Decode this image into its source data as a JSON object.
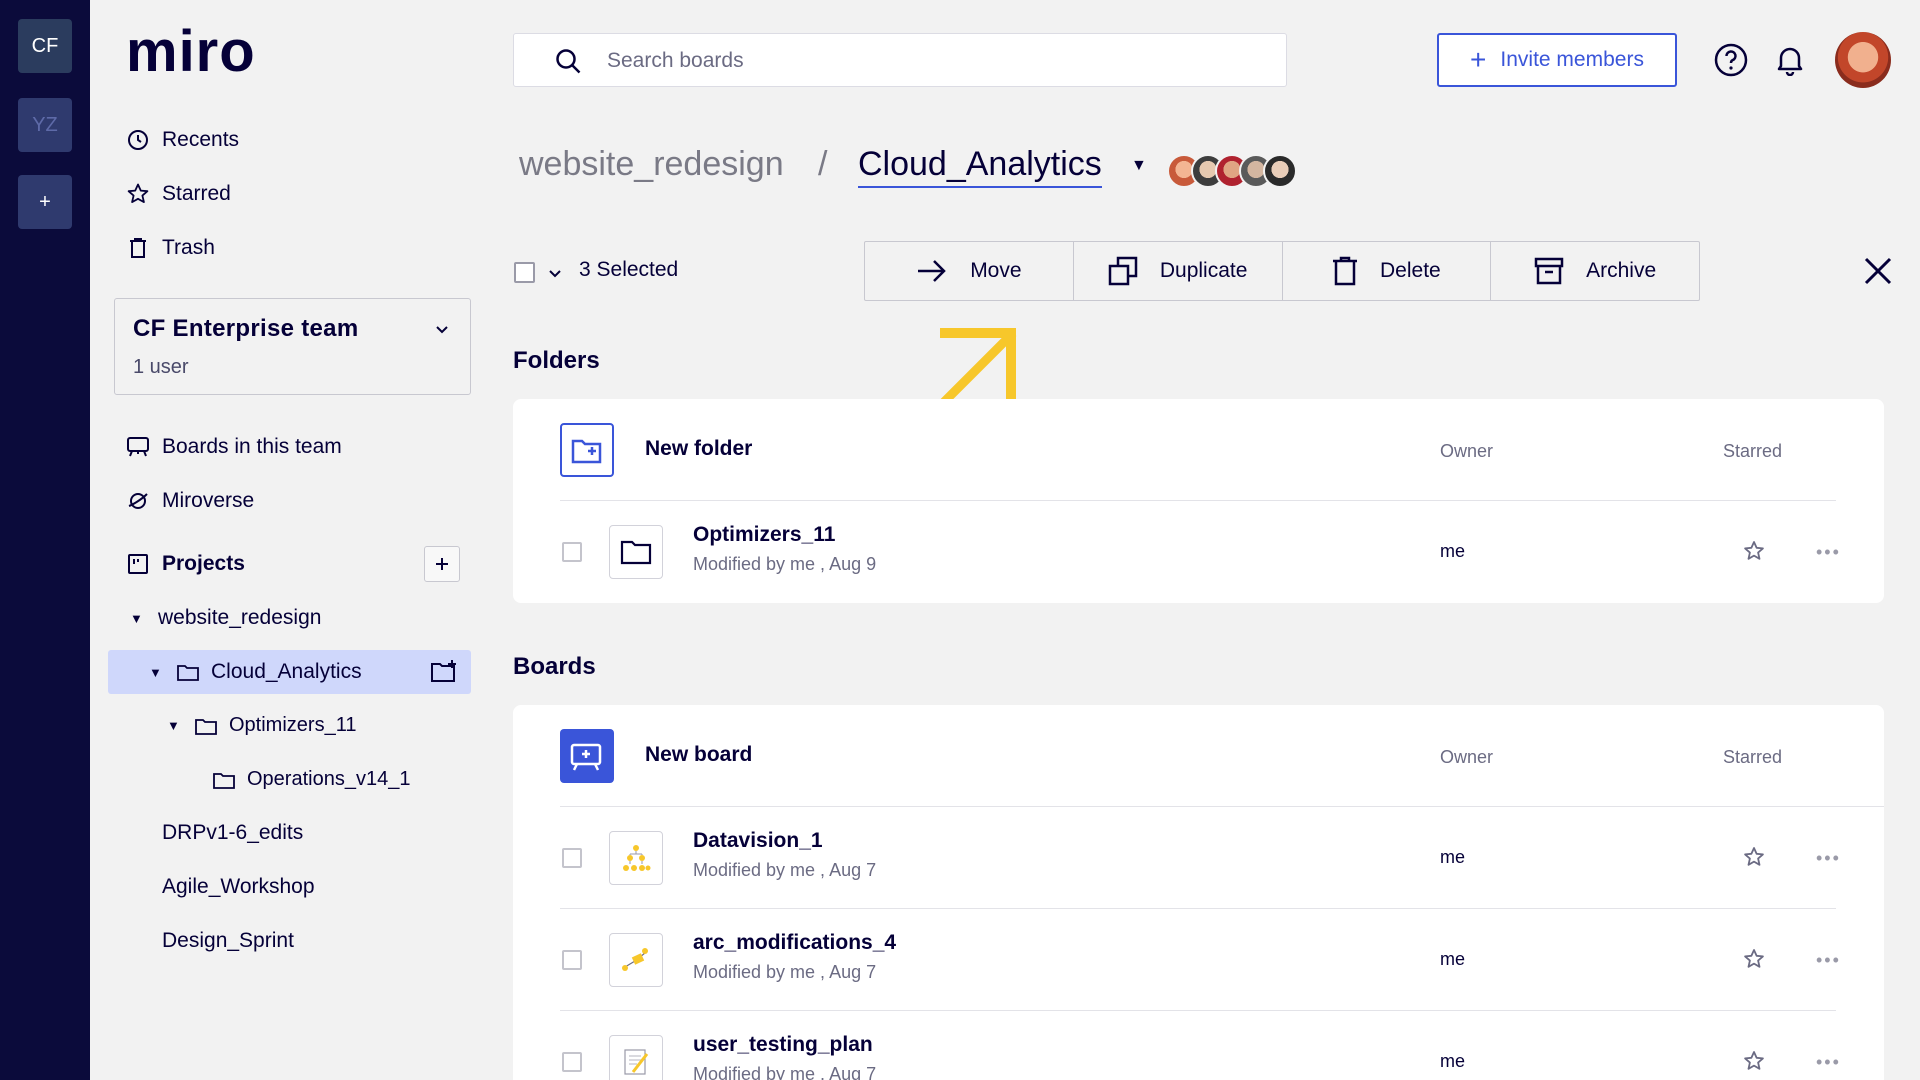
{
  "rail": {
    "workspaces": [
      {
        "initials": "CF"
      },
      {
        "initials": "YZ"
      }
    ],
    "add_label": "+"
  },
  "sidebar": {
    "logo": "miro",
    "nav": [
      {
        "label": "Recents",
        "icon": "clock-icon"
      },
      {
        "label": "Starred",
        "icon": "star-icon"
      },
      {
        "label": "Trash",
        "icon": "trash-icon"
      }
    ],
    "team": {
      "name": "CF Enterprise team",
      "users": "1 user"
    },
    "team_nav": [
      {
        "label": "Boards in this team",
        "icon": "board-icon"
      },
      {
        "label": "Miroverse",
        "icon": "planet-icon"
      }
    ],
    "projects_label": "Projects",
    "tree": [
      {
        "label": "website_redesign"
      },
      {
        "label": "Cloud_Analytics"
      },
      {
        "label": "Optimizers_11"
      },
      {
        "label": "Operations_v14_1"
      },
      {
        "label": "DRPv1-6_edits"
      },
      {
        "label": "Agile_Workshop"
      },
      {
        "label": "Design_Sprint"
      }
    ]
  },
  "header": {
    "search_placeholder": "Search boards",
    "invite_label": "Invite members"
  },
  "breadcrumb": {
    "parent": "website_redesign",
    "separator": "/",
    "current": "Cloud_Analytics"
  },
  "selection": {
    "count_label": "3 Selected",
    "actions": [
      {
        "label": "Move",
        "icon": "arrow-right-icon"
      },
      {
        "label": "Duplicate",
        "icon": "duplicate-icon"
      },
      {
        "label": "Delete",
        "icon": "trash-icon"
      },
      {
        "label": "Archive",
        "icon": "archive-icon"
      }
    ]
  },
  "folders": {
    "title": "Folders",
    "new_label": "New folder",
    "owner_col": "Owner",
    "starred_col": "Starred",
    "items": [
      {
        "name": "Optimizers_11",
        "meta": "Modified by me , Aug 9",
        "owner": "me"
      }
    ]
  },
  "boards": {
    "title": "Boards",
    "new_label": "New board",
    "owner_col": "Owner",
    "starred_col": "Starred",
    "items": [
      {
        "name": "Datavision_1",
        "meta": "Modified by me , Aug 7",
        "owner": "me"
      },
      {
        "name": "arc_modifications_4",
        "meta": "Modified by me , Aug 7",
        "owner": "me"
      },
      {
        "name": "user_testing_plan",
        "meta": "Modified by me , Aug 7",
        "owner": "me"
      }
    ]
  },
  "colors": {
    "accent": "#3a55d9",
    "rail": "#0b0b3b",
    "highlight": "#cfd7fb",
    "annotation_arrow": "#f7c72b"
  }
}
